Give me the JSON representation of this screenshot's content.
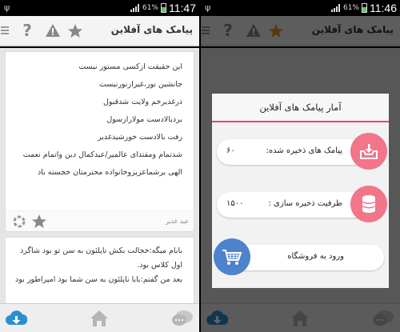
{
  "status_left": {
    "usb": "ψ",
    "clock": "11:47",
    "battery": "61%"
  },
  "status_right": {
    "usb": "ψ",
    "clock": "11:46",
    "battery": "61%"
  },
  "appbar": {
    "title": "پیامک های آفلاین"
  },
  "poem_lines": [
    "این حقیقت ازکسی مستور نیست",
    "جانشین نور،غیرازنورنیست",
    "ذرغدیرخم ولایت شدقبول",
    "بردبالادست مولارارسول",
    "رفت بالادست خورشیدغدیر",
    "شدتمام ومقتدای عالمیر/عیدکمال دین واتمام نعمت",
    "الهی برشماعزیزوخانواده محترمتان خجسته باد"
  ],
  "author": "عید غدیر",
  "second_card_lines": [
    "بابام میگه:خجالت بکش ناپلئون به سن تو بود شاگرد",
    "اول کلاس بود.",
    "بعد من گفتم:بابا ناپلئون به سن شما بود امپراطور بود"
  ],
  "dialog": {
    "title": "آمار پیامک های آفلاین",
    "saved_label": "پیامک های ذخیره شده:",
    "saved_value": "۶۰",
    "capacity_label": "ظرفیت ذخیره سازی :",
    "capacity_value": "۱۵۰۰",
    "store_label": "ورود به فروشگاه"
  },
  "colors": {
    "accent_pink": "#f2758a",
    "divider_pink": "#e4447a",
    "store_blue": "#4d82cc",
    "star_orange": "#e8951e",
    "download_blue": "#2a8fd0"
  },
  "icons": [
    "menu-icon",
    "help-icon",
    "warning-icon",
    "star-icon",
    "loading-icon",
    "cloud-download-icon",
    "home-icon",
    "chat-icon",
    "inbox-download-icon",
    "database-icon",
    "cart-icon"
  ]
}
